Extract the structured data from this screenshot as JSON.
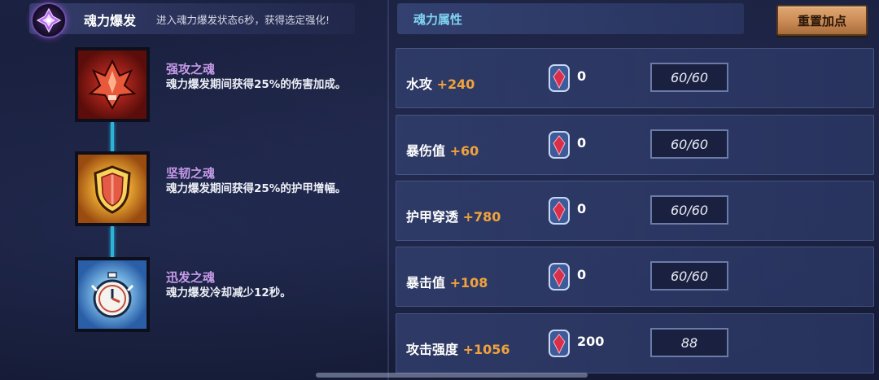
{
  "header": {
    "title": "魂力爆发",
    "description": "进入魂力爆发状态6秒，获得选定强化!"
  },
  "panel": {
    "title": "魂力属性",
    "reset_label": "重置加点"
  },
  "skills": [
    {
      "name": "强攻之魂",
      "description": "魂力爆发期间获得25%的伤害加成。",
      "icon": "red-flame-icon"
    },
    {
      "name": "坚韧之魂",
      "description": "魂力爆发期间获得25%的护甲增幅。",
      "icon": "shield-icon"
    },
    {
      "name": "迅发之魂",
      "description": "魂力爆发冷却减少12秒。",
      "icon": "stopwatch-icon"
    }
  ],
  "stats": [
    {
      "label": "水攻",
      "bonus": "+240",
      "gems": "0",
      "value": "60/60"
    },
    {
      "label": "暴伤值",
      "bonus": "+60",
      "gems": "0",
      "value": "60/60"
    },
    {
      "label": "护甲穿透",
      "bonus": "+780",
      "gems": "0",
      "value": "60/60"
    },
    {
      "label": "暴击值",
      "bonus": "+108",
      "gems": "0",
      "value": "60/60"
    },
    {
      "label": "攻击强度",
      "bonus": "+1056",
      "gems": "200",
      "value": "88"
    }
  ],
  "colors": {
    "accent_title": "#7fd3f0",
    "bonus": "#f0a23c",
    "skill_name": "#c79be8",
    "button": "#c98a54"
  }
}
